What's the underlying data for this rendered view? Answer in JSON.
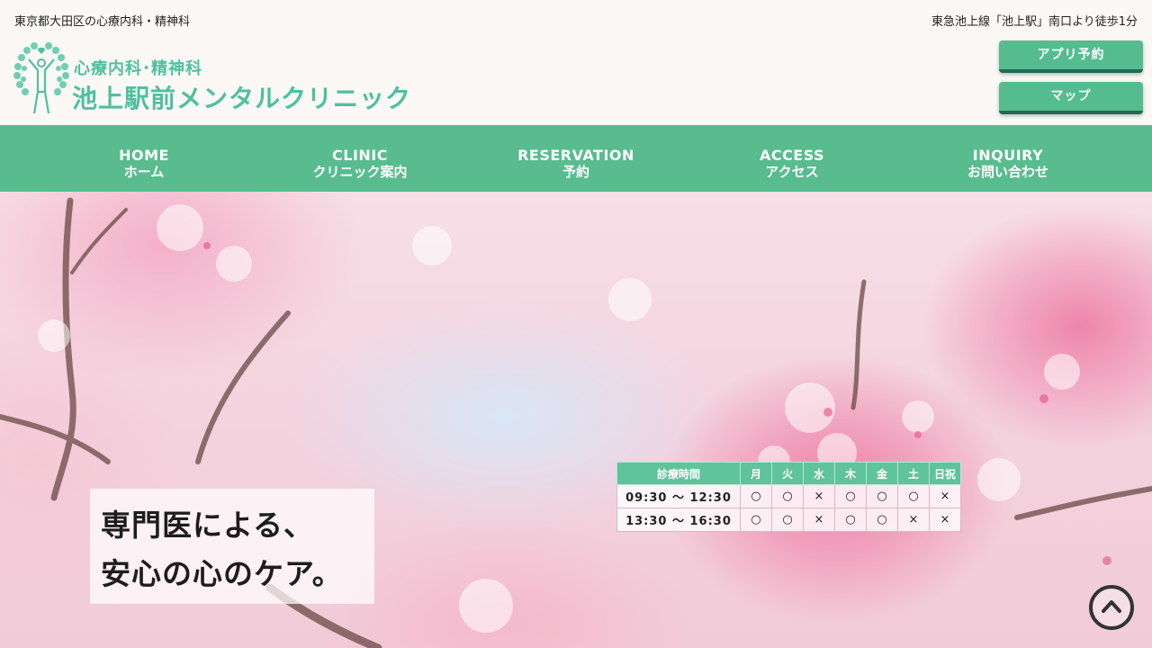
{
  "topbar": {
    "location": "東京都大田区の心療内科・精神科",
    "access_note": "東急池上線「池上駅」南口より徒歩1分"
  },
  "logo": {
    "subtitle": "心療内科･精神科",
    "name": "池上駅前メンタルクリニック",
    "icon": "tree-person-heart-icon"
  },
  "buttons": {
    "app": "アプリ予約",
    "map": "マップ"
  },
  "nav": [
    {
      "en": "HOME",
      "ja": "ホーム"
    },
    {
      "en": "CLINIC",
      "ja": "クリニック案内"
    },
    {
      "en": "RESERVATION",
      "ja": "予約"
    },
    {
      "en": "ACCESS",
      "ja": "アクセス"
    },
    {
      "en": "INQUIRY",
      "ja": "お問い合わせ"
    }
  ],
  "hero": {
    "line1": "専門医による、",
    "line2": "安心の心のケア。"
  },
  "hours": {
    "header": [
      "診療時間",
      "月",
      "火",
      "水",
      "木",
      "金",
      "土",
      "日祝"
    ],
    "rows": [
      {
        "time": "09:30 ～ 12:30",
        "days": [
          "○",
          "○",
          "×",
          "○",
          "○",
          "○",
          "×"
        ]
      },
      {
        "time": "13:30 ～ 16:30",
        "days": [
          "○",
          "○",
          "×",
          "○",
          "○",
          "×",
          "×"
        ]
      }
    ]
  },
  "colors": {
    "accent": "#58bc8f",
    "logo": "#4fc09f",
    "button_shadow": "#1f6a55"
  },
  "scroll_top": {
    "icon": "chevron-up-circle-icon"
  }
}
